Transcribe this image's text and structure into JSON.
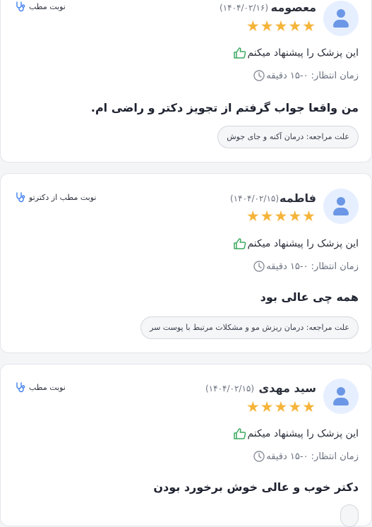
{
  "colors": {
    "star": "#f5b43a",
    "recommend_icon": "#3aa85f",
    "appointment_icon": "#3f7ff0",
    "avatar": "#6c97e6"
  },
  "reviews": [
    {
      "name": "معصومه",
      "date": "(۱۴۰۴/۰۲/۱۶)",
      "rating": 5,
      "stars": "★★★★★",
      "recommend": "این پزشک را پیشنهاد میکنم",
      "wait_time": "زمان انتظار: ۰-۱۵ دقیقه",
      "comment": "من واقعا جواب گرفتم از تجویز دکتر و راضی ام.",
      "reason": "علت مراجعه: درمان آکنه و جای جوش",
      "appointment_type": "نوبت مطب",
      "appointment_icon": "stethoscope-icon"
    },
    {
      "name": "فاطمه",
      "date": "(۱۴۰۴/۰۲/۱۵)",
      "rating": 5,
      "stars": "★★★★★",
      "recommend": "این پزشک را پیشنهاد میکنم",
      "wait_time": "زمان انتظار: ۰-۱۵ دقیقه",
      "comment": "همه چی عالی بود",
      "reason": "علت مراجعه: درمان ریزش مو و مشکلات مرتبط با پوست سر",
      "appointment_type": "نوبت مطب از دکترتو",
      "appointment_icon": "stethoscope-icon"
    },
    {
      "name": "سید مهدی",
      "date": "(۱۴۰۴/۰۲/۱۵)",
      "rating": 5,
      "stars": "★★★★★",
      "recommend": "این پزشک را پیشنهاد میکنم",
      "wait_time": "زمان انتظار: ۰-۱۵ دقیقه",
      "comment": "دکتر خوب و عالی خوش برخورد بودن",
      "reason": "",
      "appointment_type": "نوبت مطب",
      "appointment_icon": "stethoscope-icon"
    }
  ]
}
